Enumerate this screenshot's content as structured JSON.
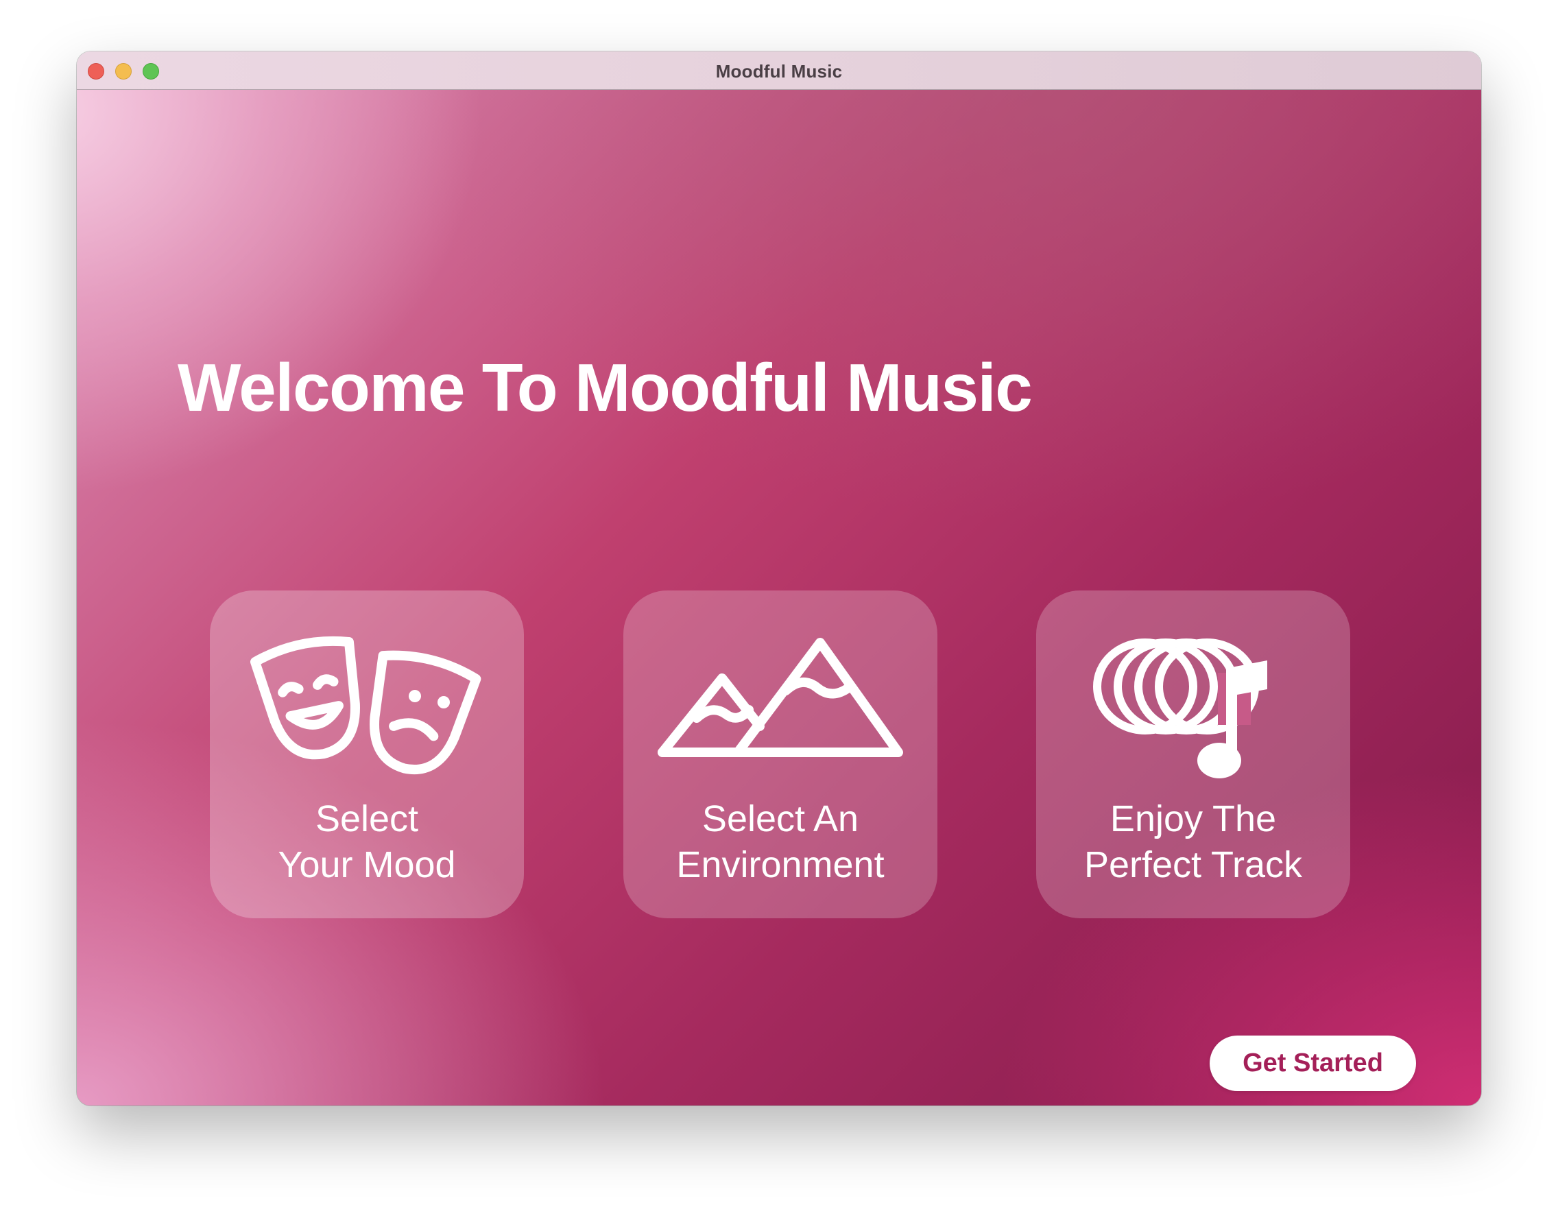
{
  "window": {
    "title": "Moodful Music"
  },
  "main": {
    "headline": "Welcome To Moodful Music",
    "cards": [
      {
        "icon": "theater-masks-icon",
        "label_line1": "Select",
        "label_line2": "Your Mood"
      },
      {
        "icon": "mountains-icon",
        "label_line1": "Select An",
        "label_line2": "Environment"
      },
      {
        "icon": "surround-music-note-icon",
        "label_line1": "Enjoy The",
        "label_line2": "Perfect Track"
      }
    ],
    "cta_label": "Get Started"
  },
  "colors": {
    "accent": "#a41f58",
    "gradient_dark": "#82194a",
    "gradient_light": "#f5c6da"
  }
}
